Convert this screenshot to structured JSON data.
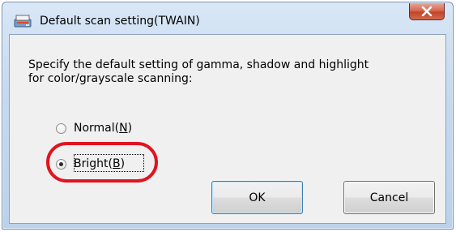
{
  "window": {
    "title": "Default scan setting(TWAIN)",
    "app_icon": "scanner-icon",
    "close_icon": "close-icon"
  },
  "dialog": {
    "prompt": "Specify the default setting of gamma, shadow and highlight\nfor color/grayscale scanning:",
    "options": [
      {
        "label": "Normal",
        "mnemonic": "N",
        "checked": false
      },
      {
        "label": "Bright",
        "mnemonic": "B",
        "checked": true
      }
    ],
    "ok_label": "OK",
    "cancel_label": "Cancel"
  },
  "colors": {
    "highlight_ring": "#e0141f",
    "close_button": "#c4432a",
    "client_bg": "#f0f0f0"
  }
}
